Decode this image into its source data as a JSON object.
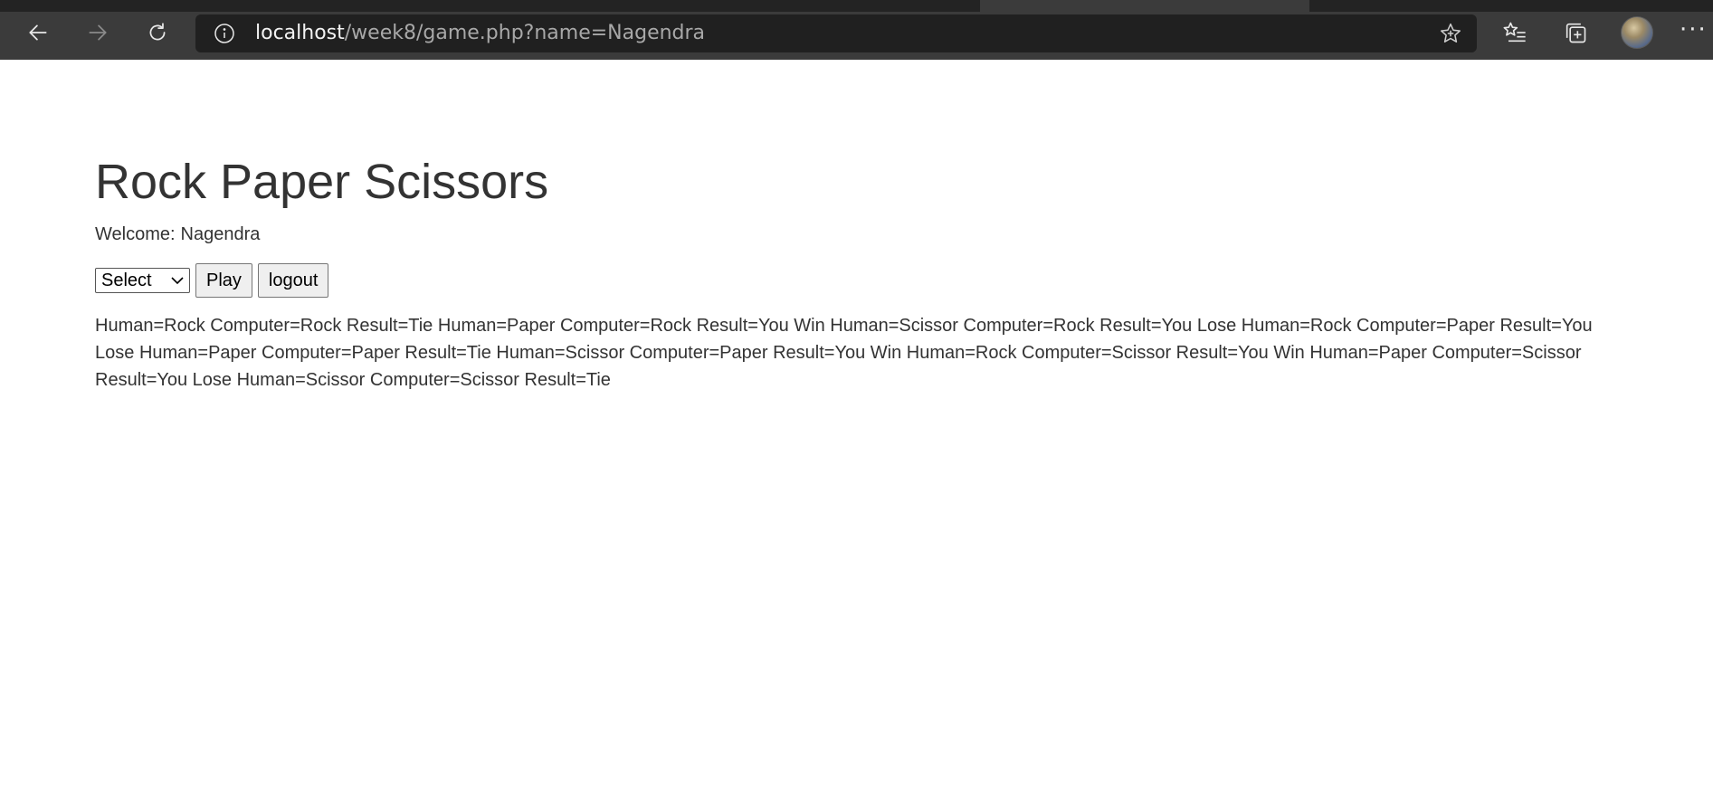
{
  "browser": {
    "url_host": "localhost",
    "url_path": "/week8/game.php?name=Nagendra",
    "more_label": "···"
  },
  "page": {
    "title": "Rock Paper Scissors",
    "welcome_label": "Welcome:",
    "welcome_name": "Nagendra",
    "select_value": "Select",
    "play_label": "Play",
    "logout_label": "logout"
  },
  "results": [
    "Human=Rock Computer=Rock Result=Tie",
    "Human=Paper Computer=Rock Result=You Win",
    "Human=Scissor Computer=Rock Result=You Lose",
    "Human=Rock Computer=Paper Result=You Lose",
    "Human=Paper Computer=Paper Result=Tie",
    "Human=Scissor Computer=Paper Result=You Win",
    "Human=Rock Computer=Scissor Result=You Win",
    "Human=Paper Computer=Scissor Result=You Lose",
    "Human=Scissor Computer=Scissor Result=Tie"
  ]
}
